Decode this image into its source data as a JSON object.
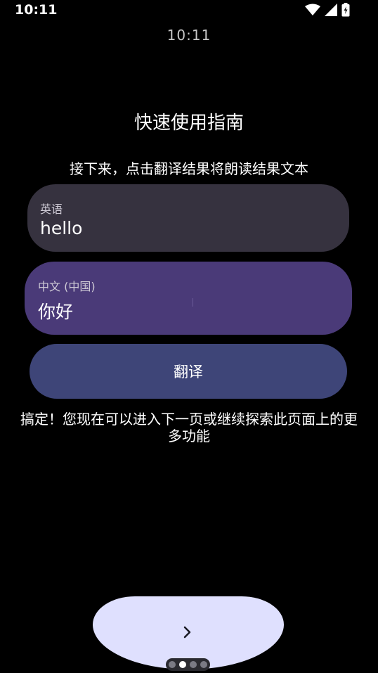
{
  "status_bar": {
    "time": "10:11",
    "icons": [
      "wifi-icon",
      "signal-icon",
      "battery-charging-icon"
    ]
  },
  "watch_face": {
    "time": "10:11"
  },
  "guide": {
    "title": "快速使用指南",
    "instruction": "接下来，点击翻译结果将朗读结果文本"
  },
  "source": {
    "language": "英语",
    "text": "hello"
  },
  "target": {
    "language": "中文 (中国)",
    "text": "你好"
  },
  "translate_button": {
    "label": "翻译"
  },
  "done_message": "搞定！您现在可以进入下一页或继续探索此页面上的更多功能",
  "next_button": {
    "icon": "chevron-right-icon"
  },
  "pagination": {
    "total": 4,
    "current": 2
  },
  "colors": {
    "background": "#000000",
    "source_card": "#36323f",
    "target_card": "#4a3a78",
    "translate_button": "#3e4578",
    "next_button": "#dfe0fe"
  }
}
